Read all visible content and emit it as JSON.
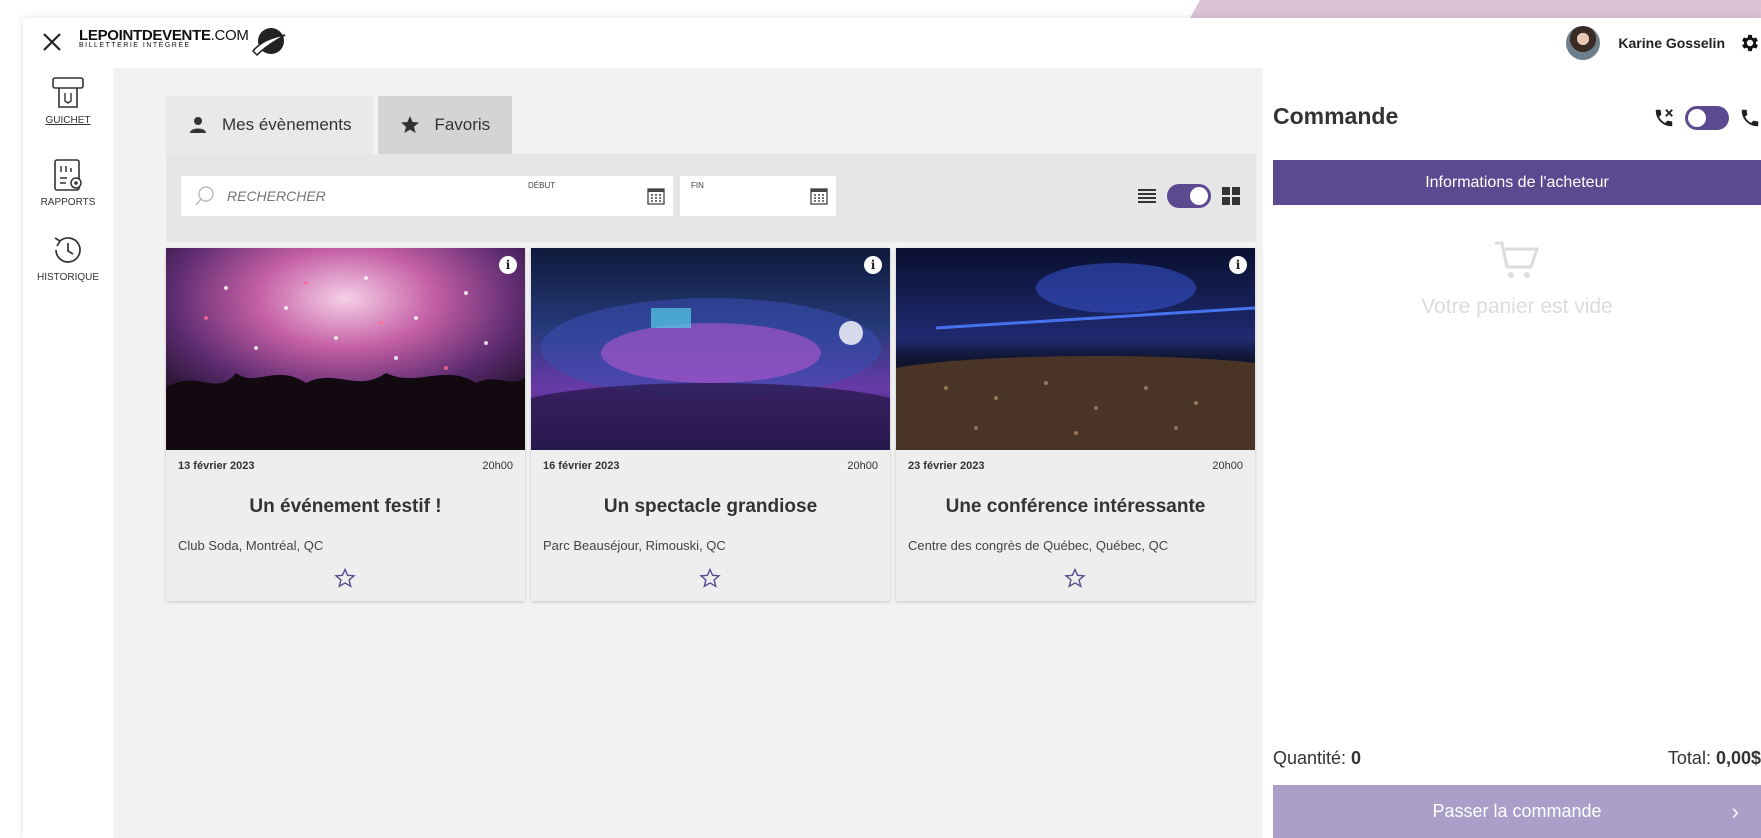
{
  "header": {
    "close_icon": "close-icon",
    "logo_main": "LEPOINTDEVENTE",
    "logo_suffix": ".COM",
    "logo_sub": "BILLETTERIE INTÉGRÉE",
    "user_name": "Karine Gosselin",
    "settings_icon": "gear-icon"
  },
  "nav": {
    "items": [
      {
        "label": "GUICHET",
        "icon": "ticket-machine-icon",
        "active": true
      },
      {
        "label": "RAPPORTS",
        "icon": "report-settings-icon",
        "active": false
      },
      {
        "label": "HISTORIQUE",
        "icon": "history-icon",
        "active": false
      }
    ]
  },
  "main": {
    "tabs": [
      {
        "label": "Mes évènements",
        "icon": "person-icon"
      },
      {
        "label": "Favoris",
        "icon": "star-icon"
      }
    ],
    "search_placeholder": "RECHERCHER",
    "start_label": "DÉBUT",
    "end_label": "FIN",
    "events": [
      {
        "date": "13 février 2023",
        "time": "20h00",
        "title": "Un événement festif !",
        "venue": "Club Soda, Montréal, QC"
      },
      {
        "date": "16 février 2023",
        "time": "20h00",
        "title": "Un spectacle grandiose",
        "venue": "Parc Beauséjour, Rimouski, QC"
      },
      {
        "date": "23 février 2023",
        "time": "20h00",
        "title": "Une conférence intéressante",
        "venue": "Centre des congrès de Québec, Québec, QC"
      }
    ]
  },
  "panel": {
    "title": "Commande",
    "buyer_button": "Informations de l'acheteur",
    "empty_cart": "Votre panier est vide",
    "quantity_label": "Quantité: ",
    "quantity_value": "0",
    "total_label": "Total: ",
    "total_value": "0,00$",
    "checkout_button": "Passer la commande",
    "checkout_chevron": "›"
  },
  "colors": {
    "accent": "#5b4a8f",
    "accent_light": "#a99fc9"
  }
}
